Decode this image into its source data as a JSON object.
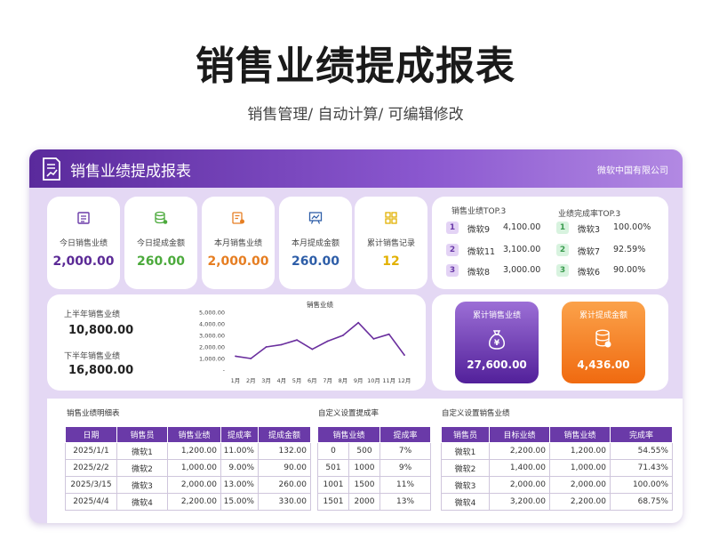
{
  "page": {
    "title": "销售业绩提成报表",
    "subtitle": "销售管理/ 自动计算/ 可编辑修改"
  },
  "header": {
    "title": "销售业绩提成报表",
    "company": "微软中国有限公司"
  },
  "kpis": [
    {
      "label": "今日销售业绩",
      "value": "2,000.00",
      "color": "#5b2a96",
      "icon": "document-icon"
    },
    {
      "label": "今日提成金额",
      "value": "260.00",
      "color": "#4caa3c",
      "icon": "database-icon"
    },
    {
      "label": "本月销售业绩",
      "value": "2,000.00",
      "color": "#e67e22",
      "icon": "report-icon"
    },
    {
      "label": "本月提成金额",
      "value": "260.00",
      "color": "#2e5ea8",
      "icon": "presentation-icon"
    },
    {
      "label": "累计销售记录",
      "value": "12",
      "color": "#e2b100",
      "icon": "grid-icon"
    }
  ],
  "top_sales": {
    "title": "销售业绩TOP.3",
    "items": [
      {
        "rank": "1",
        "name": "微软9",
        "value": "4,100.00"
      },
      {
        "rank": "2",
        "name": "微软11",
        "value": "3,100.00"
      },
      {
        "rank": "3",
        "name": "微软8",
        "value": "3,000.00"
      }
    ]
  },
  "top_rate": {
    "title": "业绩完成率TOP.3",
    "items": [
      {
        "rank": "1",
        "name": "微软3",
        "value": "100.00%"
      },
      {
        "rank": "2",
        "name": "微软7",
        "value": "92.59%"
      },
      {
        "rank": "3",
        "name": "微软6",
        "value": "90.00%"
      }
    ]
  },
  "halves": {
    "h1_label": "上半年销售业绩",
    "h1_value": "10,800.00",
    "h2_label": "下半年销售业绩",
    "h2_value": "16,800.00"
  },
  "chart_data": {
    "type": "line",
    "title": "销售业绩",
    "categories": [
      "1月",
      "2月",
      "3月",
      "4月",
      "5月",
      "6月",
      "7月",
      "8月",
      "9月",
      "10月",
      "11月",
      "12月"
    ],
    "values": [
      1200,
      1000,
      2000,
      2200,
      2600,
      1800,
      2500,
      3000,
      4100,
      2700,
      3100,
      1300
    ],
    "ylim": [
      0,
      5000
    ],
    "yticks": [
      "5,000.00",
      "4,000.00",
      "3,000.00",
      "2,000.00",
      "1,000.00",
      "-"
    ],
    "line_color": "#6a2f9e",
    "grid": false
  },
  "totals": {
    "sales_label": "累计销售业绩",
    "sales_value": "27,600.00",
    "commission_label": "累计提成金额",
    "commission_value": "4,436.00"
  },
  "detail": {
    "title": "销售业绩明细表",
    "headers": [
      "日期",
      "销售员",
      "销售业绩",
      "提成率",
      "提成金额"
    ],
    "rows": [
      [
        "2025/1/1",
        "微软1",
        "1,200.00",
        "11.00%",
        "132.00"
      ],
      [
        "2025/2/2",
        "微软2",
        "1,000.00",
        "9.00%",
        "90.00"
      ],
      [
        "2025/3/15",
        "微软3",
        "2,000.00",
        "13.00%",
        "260.00"
      ],
      [
        "2025/4/4",
        "微软4",
        "2,200.00",
        "15.00%",
        "330.00"
      ]
    ]
  },
  "rate_setting": {
    "title": "自定义设置提成率",
    "headers": [
      "销售业绩",
      "提成率"
    ],
    "rows": [
      [
        "0",
        "500",
        "7%"
      ],
      [
        "501",
        "1000",
        "9%"
      ],
      [
        "1001",
        "1500",
        "11%"
      ],
      [
        "1501",
        "2000",
        "13%"
      ]
    ]
  },
  "target_setting": {
    "title": "自定义设置销售业绩",
    "headers": [
      "销售员",
      "目标业绩",
      "销售业绩",
      "完成率"
    ],
    "rows": [
      [
        "微软1",
        "2,200.00",
        "1,200.00",
        "54.55%"
      ],
      [
        "微软2",
        "1,400.00",
        "1,000.00",
        "71.43%"
      ],
      [
        "微软3",
        "2,000.00",
        "2,000.00",
        "100.00%"
      ],
      [
        "微软4",
        "3,200.00",
        "2,200.00",
        "68.75%"
      ]
    ]
  }
}
